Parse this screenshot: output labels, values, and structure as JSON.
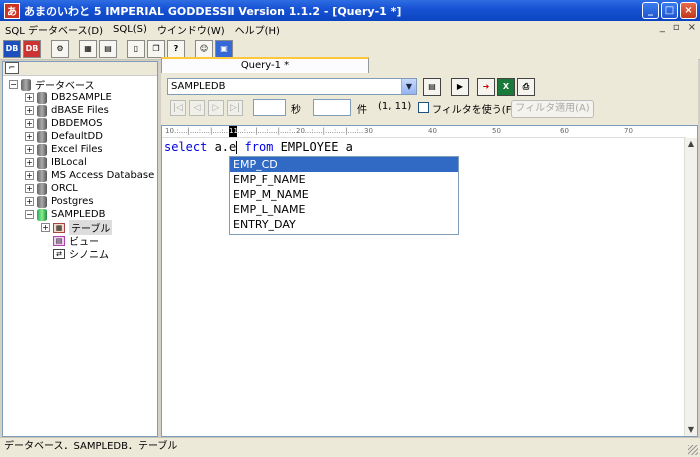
{
  "window": {
    "title": "あまのいわと 5  IMPERIAL GODDESSⅡ  Version 1.1.2 - [Query-1 *]",
    "app_icon": "あ"
  },
  "menu": [
    "SQL データベース(D)",
    "SQL(S)",
    "ウインドウ(W)",
    "ヘルプ(H)"
  ],
  "tree": {
    "root": "データベース",
    "items": [
      "DB2SAMPLE",
      "dBASE Files",
      "DBDEMOS",
      "DefaultDD",
      "Excel Files",
      "IBLocal",
      "MS Access Database",
      "ORCL",
      "Postgres",
      "SAMPLEDB"
    ],
    "children": [
      "テーブル",
      "ビュー",
      "シノニム"
    ]
  },
  "tab": {
    "label": "Query-1 *"
  },
  "query": {
    "database": "SAMPLEDB",
    "seconds_label": "秒",
    "count_label": "件",
    "position": "(1, 11)",
    "filter_label": "フィルタを使う(F)",
    "apply_label": "フィルタ適用(A)"
  },
  "editor": {
    "kw1": "select",
    "mid": " a.e",
    "kw2": "from",
    "rest": " EMPLOYEE a",
    "ruler": [
      "10",
      "20",
      "30",
      "40",
      "50",
      "60",
      "70"
    ]
  },
  "autocomplete": [
    "EMP_CD",
    "EMP_F_NAME",
    "EMP_M_NAME",
    "EMP_L_NAME",
    "ENTRY_DAY"
  ],
  "status": {
    "path": "データベース．SAMPLEDB．テーブル"
  },
  "colors": {
    "title_bar": "#0b44c0",
    "selection": "#316ac5",
    "keyword": "#0000e0"
  }
}
